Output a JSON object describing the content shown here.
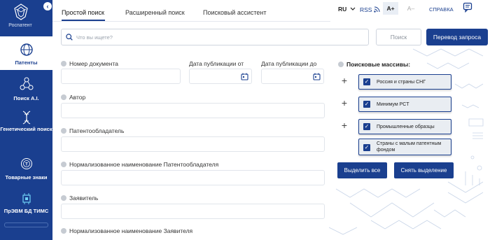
{
  "brand": {
    "name": "Роспатент"
  },
  "sidebar": {
    "collapse_icon": "chevron-left-icon",
    "items": [
      {
        "label": "Патенты",
        "icon": "globe-icon",
        "active": true
      },
      {
        "label": "Поиск A.I.",
        "icon": "network-icon",
        "active": false
      },
      {
        "label": "Генетический поиск",
        "icon": "dna-icon",
        "active": false
      },
      {
        "label": "Товарные знаки",
        "icon": "trademark-icon",
        "active": false
      },
      {
        "label": "ПрЭВМ БД ТИМС",
        "icon": "chip-icon",
        "active": false
      }
    ]
  },
  "tabs": [
    {
      "label": "Простой поиск",
      "active": true
    },
    {
      "label": "Расширенный поиск",
      "active": false
    },
    {
      "label": "Поисковый ассистент",
      "active": false
    }
  ],
  "header": {
    "language": "RU",
    "rss": "RSS",
    "font_increase": "A+",
    "font_decrease": "A–",
    "help": "СПРАВКА",
    "chat_icon": "chat-icon"
  },
  "search": {
    "placeholder": "Что вы ищете?",
    "value": "",
    "search_button": "Поиск",
    "translate_button": "Перевод запроса"
  },
  "fields": {
    "doc_number": "Номер документа",
    "pub_date_from": "Дата публикации от",
    "pub_date_to": "Дата публикации до",
    "author": "Автор",
    "patent_holder": "Патентообладатель",
    "norm_patent_holder": "Нормализованное наименование Патентообладателя",
    "applicant": "Заявитель",
    "norm_applicant": "Нормализованное наименование Заявителя"
  },
  "databases": {
    "title": "Поисковые массивы:",
    "items": [
      {
        "label": "Россия и страны СНГ",
        "checked": true
      },
      {
        "label": "Минимум PCT",
        "checked": true
      },
      {
        "label": "Промышленные образцы",
        "checked": true
      },
      {
        "label": "Страны с малым патентным фондом",
        "checked": true
      }
    ],
    "select_all": "Выделить все",
    "deselect_all": "Снять выделение"
  },
  "colors": {
    "primary": "#1a3f8f",
    "accent_light": "#e9edf2"
  }
}
